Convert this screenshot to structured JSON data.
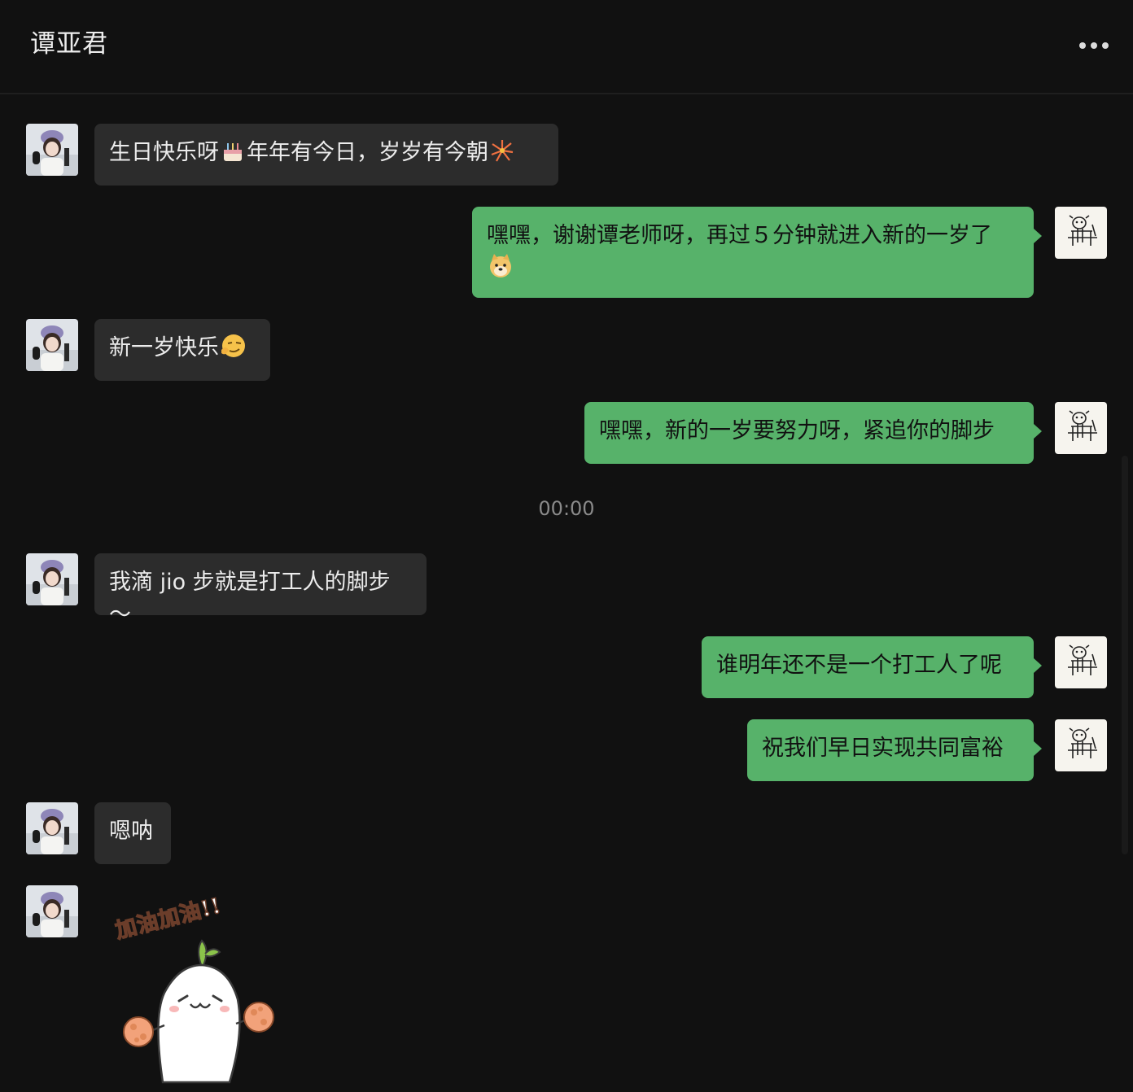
{
  "chat": {
    "title": "谭亚君",
    "time_divider": "00:00"
  },
  "messages": [
    {
      "from": "in",
      "text": "生日快乐呀",
      "emoji1": "cake-emoji",
      "text2": "年年有今日，岁岁有今朝",
      "emoji2": "fireworks-emoji"
    },
    {
      "from": "out",
      "text": "嘿嘿，谢谢谭老师呀，再过５分钟就进入新的一岁了",
      "emoji": "doge-emoji"
    },
    {
      "from": "in",
      "text": "新一岁快乐",
      "emoji": "smirk-emoji"
    },
    {
      "from": "out",
      "text": "嘿嘿，新的一岁要努力呀，紧追你的脚步"
    },
    {
      "from": "in",
      "text": "我滴 jio 步就是打工人的脚步～"
    },
    {
      "from": "out",
      "text": "谁明年还不是一个打工人了呢"
    },
    {
      "from": "out",
      "text": "祝我们早日实现共同富裕"
    },
    {
      "from": "in",
      "text": "嗯呐"
    },
    {
      "from": "in",
      "sticker": {
        "caption": "加油加油!!",
        "icon": "cheerleader-sticker"
      }
    }
  ],
  "colors": {
    "background": "#111111",
    "incoming_bubble": "#2c2c2c",
    "outgoing_bubble": "#57b26a"
  }
}
